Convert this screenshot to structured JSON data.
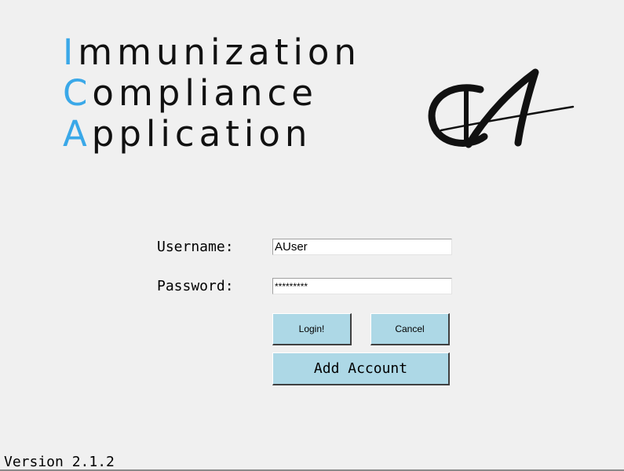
{
  "logo": {
    "line1": {
      "initial": "I",
      "rest": "mmunization"
    },
    "line2": {
      "initial": "C",
      "rest": "ompliance"
    },
    "line3": {
      "initial": "A",
      "rest": "pplication"
    },
    "initial_color": "#3aa8e8",
    "mark_icon": "ica-monogram-icon"
  },
  "form": {
    "username_label": "Username:",
    "username_value": "AUser",
    "password_label": "Password:",
    "password_value": "*********"
  },
  "buttons": {
    "login": "Login!",
    "cancel": "Cancel",
    "add_account": "Add Account",
    "color": "#add8e6"
  },
  "footer": {
    "version": "Version 2.1.2"
  }
}
